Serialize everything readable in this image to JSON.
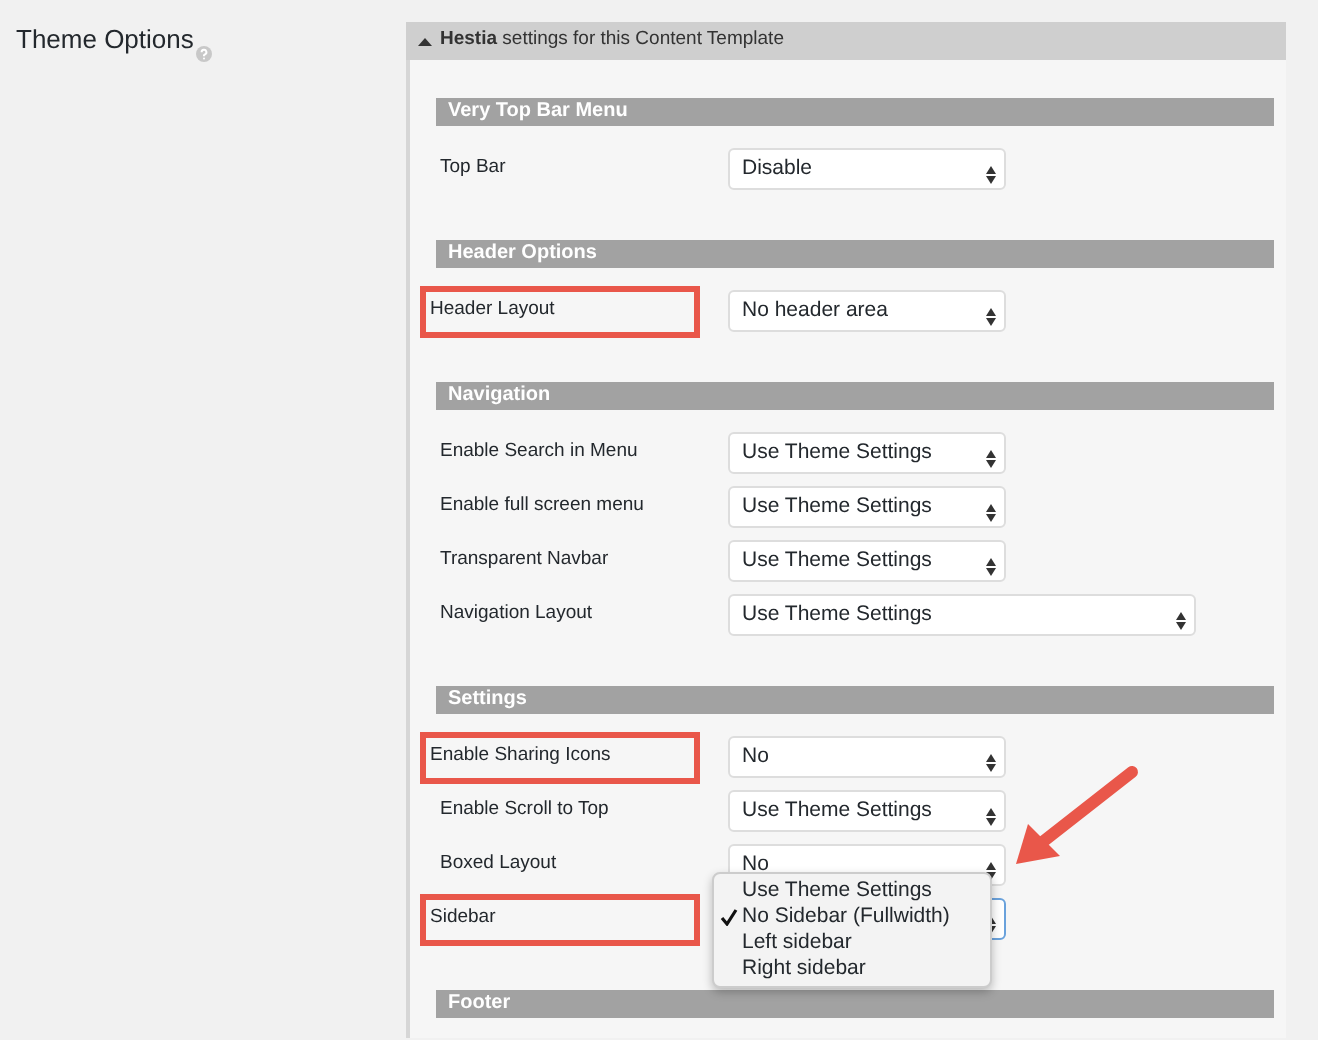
{
  "page_label": "Theme Options",
  "panel": {
    "title": "**Hestia** settings for this Content Template",
    "expanded": true
  },
  "sections": [
    {
      "title": "Very Top Bar Menu",
      "rows": [
        {
          "label": "Top Bar",
          "value": "Disable",
          "wide": false,
          "highlighted": false,
          "open": false
        }
      ]
    },
    {
      "title": "Header Options",
      "rows": [
        {
          "label": "Header Layout",
          "value": "No header area",
          "wide": false,
          "highlighted": true,
          "open": false
        }
      ]
    },
    {
      "title": "Navigation",
      "rows": [
        {
          "label": "Enable Search in Menu",
          "value": "Use Theme Settings",
          "wide": false,
          "highlighted": false,
          "open": false
        },
        {
          "label": "Enable full screen menu",
          "value": "Use Theme Settings",
          "wide": false,
          "highlighted": false,
          "open": false
        },
        {
          "label": "Transparent Navbar",
          "value": "Use Theme Settings",
          "wide": false,
          "highlighted": false,
          "open": false
        },
        {
          "label": "Navigation Layout",
          "value": "Use Theme Settings",
          "wide": true,
          "highlighted": false,
          "open": false
        }
      ]
    },
    {
      "title": "Settings",
      "rows": [
        {
          "label": "Enable Sharing Icons",
          "value": "No",
          "wide": false,
          "highlighted": true,
          "open": false
        },
        {
          "label": "Enable Scroll to Top",
          "value": "Use Theme Settings",
          "wide": false,
          "highlighted": false,
          "open": false
        },
        {
          "label": "Boxed Layout",
          "value": "No",
          "wide": false,
          "highlighted": false,
          "open": false
        },
        {
          "label": "Sidebar",
          "wide": false,
          "highlighted": true,
          "open": true,
          "options": [
            {
              "label": "Use Theme Settings",
              "selected": false
            },
            {
              "label": "No Sidebar (Fullwidth)",
              "selected": true
            },
            {
              "label": "Left sidebar",
              "selected": false
            },
            {
              "label": "Right sidebar",
              "selected": false
            }
          ]
        }
      ]
    },
    {
      "title": "Footer"
    }
  ],
  "annotation": {
    "kind": "arrow"
  }
}
